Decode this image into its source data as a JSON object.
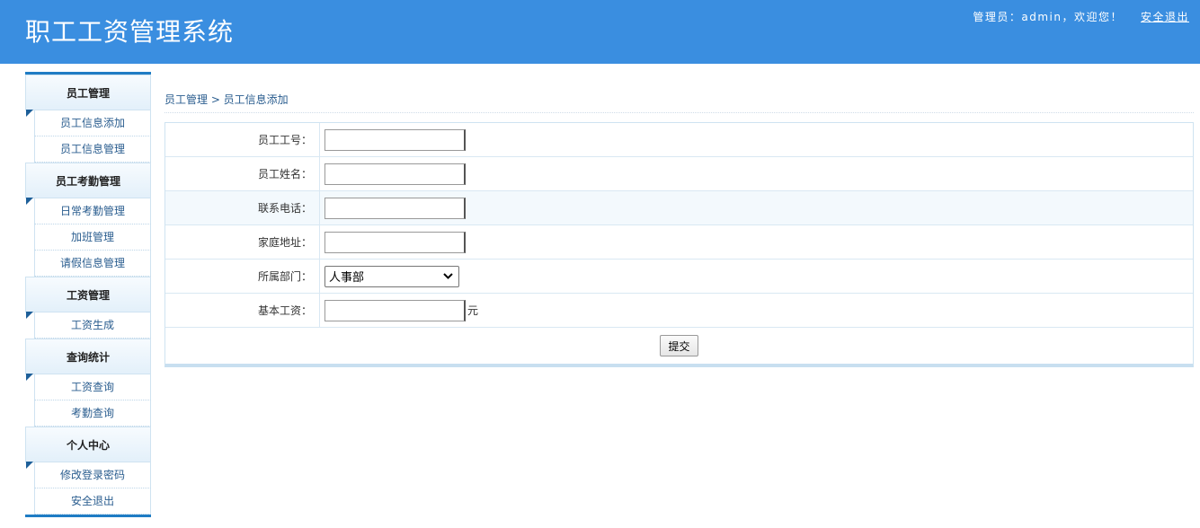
{
  "header": {
    "title": "职工工资管理系统",
    "welcome": "管理员：admin，欢迎您！",
    "logout": "安全退出"
  },
  "sidebar": {
    "sections": [
      {
        "title": "员工管理",
        "items": [
          "员工信息添加",
          "员工信息管理"
        ]
      },
      {
        "title": "员工考勤管理",
        "items": [
          "日常考勤管理",
          "加班管理",
          "请假信息管理"
        ]
      },
      {
        "title": "工资管理",
        "items": [
          "工资生成"
        ]
      },
      {
        "title": "查询统计",
        "items": [
          "工资查询",
          "考勤查询"
        ]
      },
      {
        "title": "个人中心",
        "items": [
          "修改登录密码",
          "安全退出"
        ]
      }
    ]
  },
  "breadcrumb": "员工管理 > 员工信息添加",
  "form": {
    "emp_no_label": "员工工号：",
    "emp_no_value": "",
    "name_label": "员工姓名：",
    "name_value": "",
    "phone_label": "联系电话：",
    "phone_value": "",
    "address_label": "家庭地址：",
    "address_value": "",
    "dept_label": "所属部门：",
    "dept_selected": "人事部",
    "salary_label": "基本工资：",
    "salary_value": "",
    "salary_unit": "元",
    "submit_label": "提交"
  },
  "icons": {
    "dropdown": "chevron-down-icon",
    "section_corner": "corner-triangle-icon"
  },
  "colors": {
    "header_bg": "#3a8ee0",
    "sidebar_accent": "#1f7cc4",
    "link_text": "#2a5d8f"
  }
}
